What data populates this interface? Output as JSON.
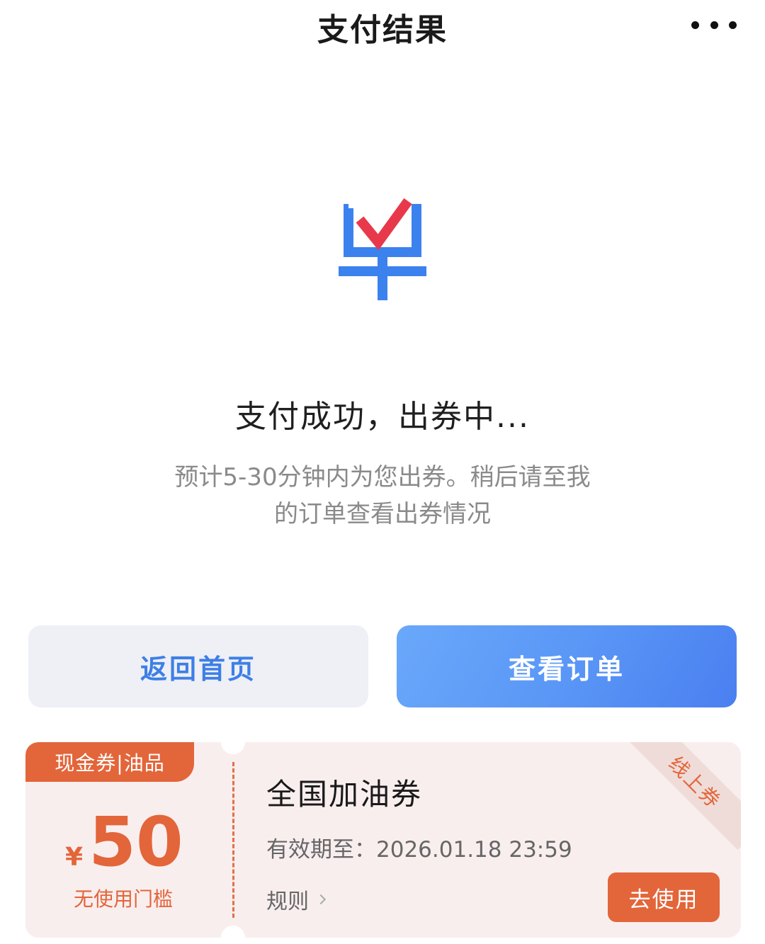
{
  "header": {
    "title": "支付结果",
    "more_icon": "more-horizontal-icon"
  },
  "status": {
    "icon": "order-check-icon",
    "title": "支付成功，出券中...",
    "description_line1": "预计5-30分钟内为您出券。稍后请至我",
    "description_line2": "的订单查看出券情况"
  },
  "actions": {
    "home_label": "返回首页",
    "order_label": "查看订单"
  },
  "coupon": {
    "tag": "现金券|油品",
    "currency": "¥",
    "amount": "50",
    "threshold": "无使用门槛",
    "name": "全国加油券",
    "expiry": "有效期至：2026.01.18 23:59",
    "rule_label": "规则",
    "use_label": "去使用",
    "ribbon": "线上券"
  },
  "colors": {
    "accent_blue": "#4a7ff0",
    "coupon_orange": "#e3653a",
    "check_red": "#e8394a"
  }
}
